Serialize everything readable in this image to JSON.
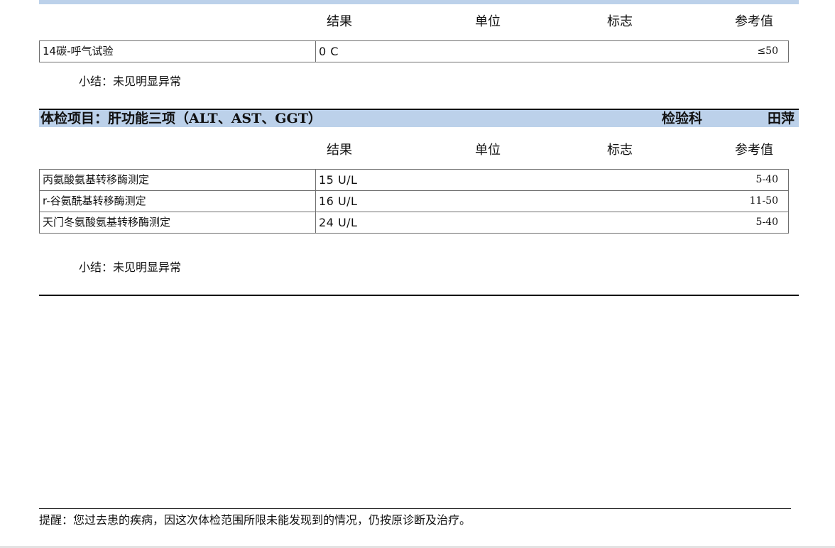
{
  "sections": [
    {
      "title": "",
      "dept": "",
      "doctor": "",
      "columns": {
        "result": "结果",
        "unit": "单位",
        "flag": "标志",
        "ref": "参考值"
      },
      "rows": [
        {
          "name": "14碳-呼气试验",
          "value": "0  C",
          "ref": "≤50"
        }
      ],
      "summary": "小结：未见明显异常"
    },
    {
      "title": "体检项目：肝功能三项（ALT、AST、GGT）",
      "dept": "检验科",
      "doctor": "田萍",
      "columns": {
        "result": "结果",
        "unit": "单位",
        "flag": "标志",
        "ref": "参考值"
      },
      "rows": [
        {
          "name": "丙氨酸氨基转移酶测定",
          "value": "15  U/L",
          "ref": "5-40"
        },
        {
          "name": "r-谷氨酰基转移酶测定",
          "value": "16  U/L",
          "ref": "11-50"
        },
        {
          "name": "天门冬氨酸氨基转移酶测定",
          "value": "24  U/L",
          "ref": "5-40"
        }
      ],
      "summary": "小结：未见明显异常"
    }
  ],
  "reminder": "提醒：您过去患的疾病，因这次体检范围所限未能发现到的情况，仍按原诊断及治疗。",
  "colors": {
    "header_band": "#bcd1ea",
    "rule": "#111111",
    "grid_border": "#6f6f6f"
  }
}
